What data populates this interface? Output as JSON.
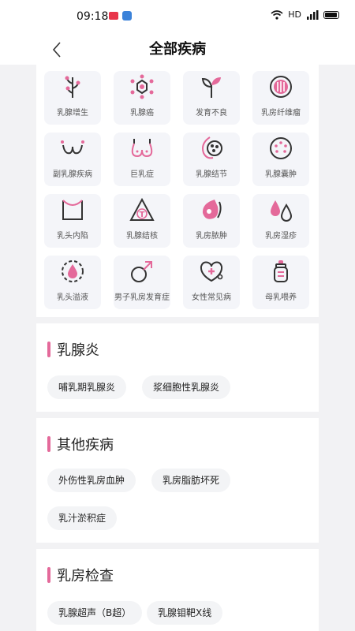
{
  "status": {
    "time": "09:18",
    "network": "HD",
    "signal": "4G"
  },
  "header": {
    "title": "全部疾病"
  },
  "grid": [
    {
      "label": "乳腺增生",
      "icon": "branch-icon"
    },
    {
      "label": "乳腺癌",
      "icon": "cell-icon"
    },
    {
      "label": "发育不良",
      "icon": "sprout-icon"
    },
    {
      "label": "乳房纤维瘤",
      "icon": "tumor-icon"
    },
    {
      "label": "副乳腺疾病",
      "icon": "accessory-breast-icon"
    },
    {
      "label": "巨乳症",
      "icon": "large-breast-icon"
    },
    {
      "label": "乳腺结节",
      "icon": "nodule-icon"
    },
    {
      "label": "乳腺囊肿",
      "icon": "cyst-icon"
    },
    {
      "label": "乳头内陷",
      "icon": "inverted-nipple-icon"
    },
    {
      "label": "乳腺结核",
      "icon": "tuberculosis-icon"
    },
    {
      "label": "乳房脓肿",
      "icon": "abscess-icon"
    },
    {
      "label": "乳房湿疹",
      "icon": "drops-icon"
    },
    {
      "label": "乳头溢液",
      "icon": "discharge-icon"
    },
    {
      "label": "男子乳房发育症",
      "icon": "male-symbol-icon"
    },
    {
      "label": "女性常见病",
      "icon": "stethoscope-icon"
    },
    {
      "label": "母乳喂养",
      "icon": "baby-bottle-icon"
    }
  ],
  "sections": [
    {
      "title": "乳腺炎",
      "chips": [
        "哺乳期乳腺炎",
        "浆细胞性乳腺炎"
      ]
    },
    {
      "title": "其他疾病",
      "chips": [
        "外伤性乳房血肿",
        "乳房脂肪坏死",
        "乳汁淤积症"
      ]
    },
    {
      "title": "乳房检查",
      "chips": [
        "乳腺超声（B超）",
        "乳腺钼靶X线"
      ]
    }
  ],
  "colors": {
    "accent": "#e4699a",
    "icon_dark": "#333333",
    "tile_bg": "#f4f5f9"
  }
}
